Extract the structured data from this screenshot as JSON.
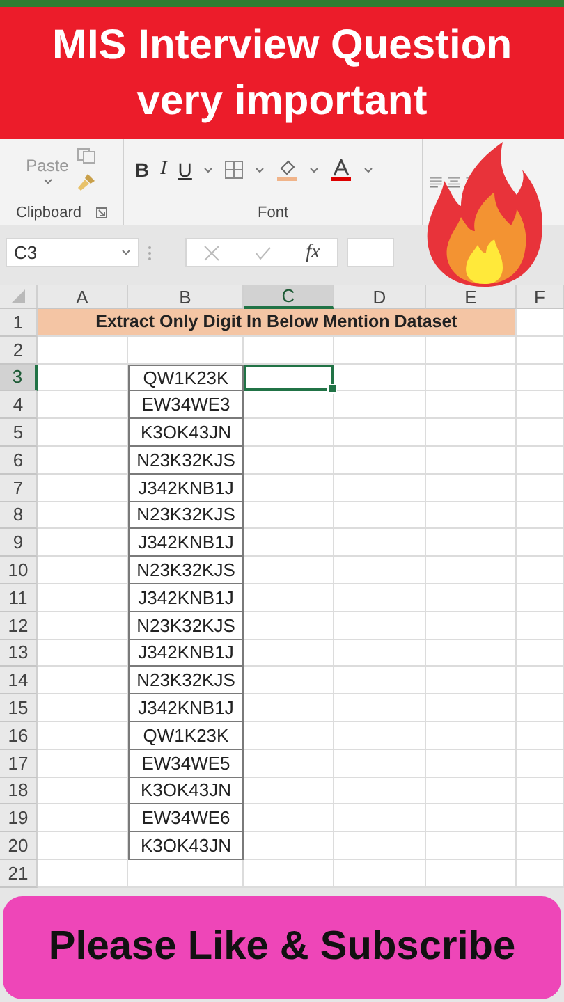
{
  "banner": {
    "lines": [
      "MIS Interview Question",
      "very important"
    ]
  },
  "ribbon": {
    "paste": "Paste",
    "format_buttons": [
      {
        "label": "B",
        "kind": "bold"
      },
      {
        "label": "I",
        "kind": "italic"
      },
      {
        "label": "U",
        "kind": "underline"
      }
    ],
    "groups": [
      {
        "label": "Clipboard"
      },
      {
        "label": "Font"
      }
    ]
  },
  "formula_bar": {
    "name_box": "C3",
    "function_label": "fx"
  },
  "sheet": {
    "columns": [
      {
        "label": "A",
        "selected": false
      },
      {
        "label": "B",
        "selected": false
      },
      {
        "label": "C",
        "selected": true
      },
      {
        "label": "D",
        "selected": false
      },
      {
        "label": "E",
        "selected": false
      },
      {
        "label": "F",
        "selected": false
      }
    ],
    "rows": [
      {
        "label": "1",
        "selected": false,
        "kind": "title",
        "text": "Extract Only Digit In Below Mention Dataset"
      },
      {
        "label": "2",
        "selected": false,
        "kind": "empty"
      },
      {
        "label": "3",
        "selected": true,
        "kind": "data",
        "text": "QW1K23K"
      },
      {
        "label": "4",
        "selected": false,
        "kind": "data",
        "text": "EW34WE3"
      },
      {
        "label": "5",
        "selected": false,
        "kind": "data",
        "text": "K3OK43JN"
      },
      {
        "label": "6",
        "selected": false,
        "kind": "data",
        "text": "N23K32KJS"
      },
      {
        "label": "7",
        "selected": false,
        "kind": "data",
        "text": "J342KNB1J"
      },
      {
        "label": "8",
        "selected": false,
        "kind": "data",
        "text": "N23K32KJS"
      },
      {
        "label": "9",
        "selected": false,
        "kind": "data",
        "text": "J342KNB1J"
      },
      {
        "label": "10",
        "selected": false,
        "kind": "data",
        "text": "N23K32KJS"
      },
      {
        "label": "11",
        "selected": false,
        "kind": "data",
        "text": "J342KNB1J"
      },
      {
        "label": "12",
        "selected": false,
        "kind": "data",
        "text": "N23K32KJS"
      },
      {
        "label": "13",
        "selected": false,
        "kind": "data",
        "text": "J342KNB1J"
      },
      {
        "label": "14",
        "selected": false,
        "kind": "data",
        "text": "N23K32KJS"
      },
      {
        "label": "15",
        "selected": false,
        "kind": "data",
        "text": "J342KNB1J"
      },
      {
        "label": "16",
        "selected": false,
        "kind": "data",
        "text": "QW1K23K"
      },
      {
        "label": "17",
        "selected": false,
        "kind": "data",
        "text": "EW34WE5"
      },
      {
        "label": "18",
        "selected": false,
        "kind": "data",
        "text": "K3OK43JN"
      },
      {
        "label": "19",
        "selected": false,
        "kind": "data",
        "text": "EW34WE6"
      },
      {
        "label": "20",
        "selected": false,
        "kind": "data",
        "text": "K3OK43JN"
      },
      {
        "label": "21",
        "selected": false,
        "kind": "empty"
      }
    ]
  },
  "footer": {
    "text": "Please Like & Subscribe"
  }
}
